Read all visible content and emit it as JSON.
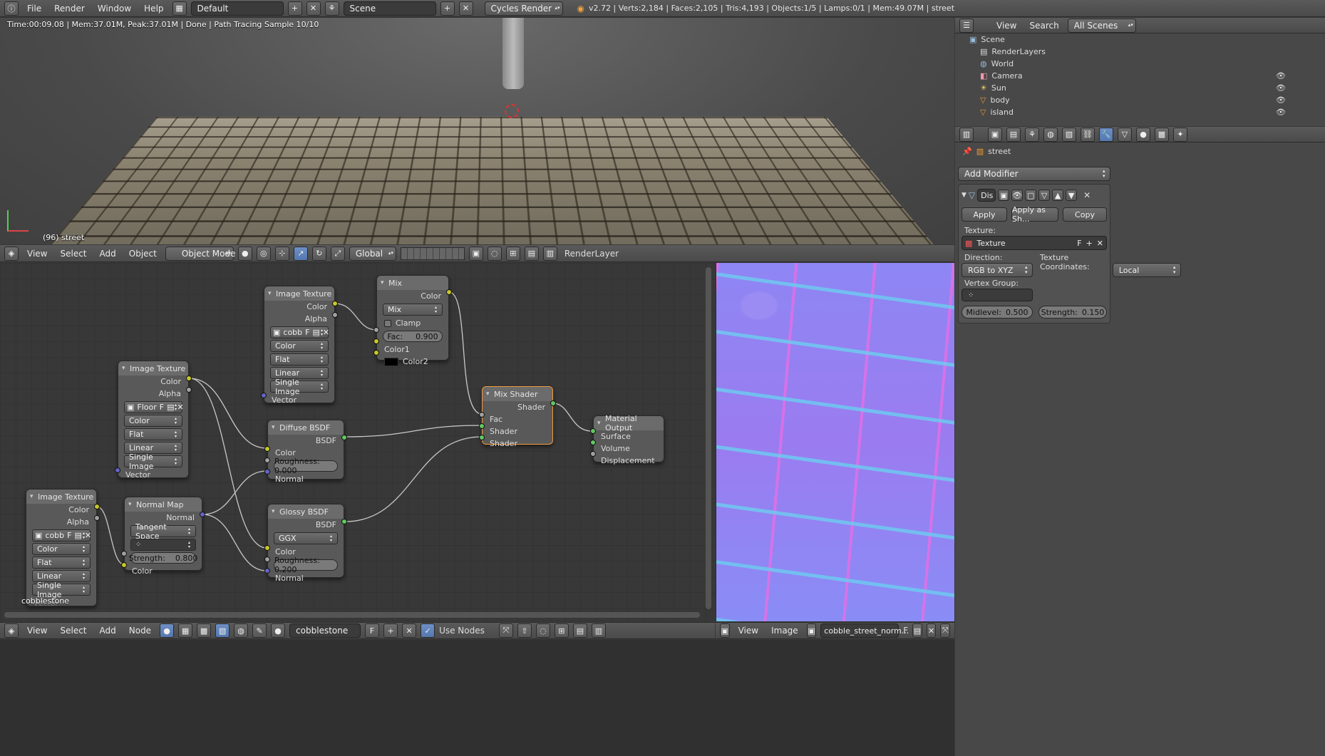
{
  "topbar": {
    "menus": [
      "File",
      "Render",
      "Window",
      "Help"
    ],
    "layout": "Default",
    "scene": "Scene",
    "engine": "Cycles Render",
    "stats": "v2.72 | Verts:2,184 | Faces:2,105 | Tris:4,193 | Objects:1/5 | Lamps:0/1 | Mem:49.07M | street"
  },
  "viewport": {
    "info": "Time:00:09.08 | Mem:37.01M, Peak:37.01M | Done | Path Tracing Sample 10/10",
    "object_label": "(96) street",
    "menus": [
      "View",
      "Select",
      "Add",
      "Object"
    ],
    "mode": "Object Mode",
    "orientation": "Global",
    "render_layer": "RenderLayer"
  },
  "outliner": {
    "menus": [
      "View",
      "Search"
    ],
    "filter": "All Scenes",
    "items": [
      "Scene",
      "RenderLayers",
      "World",
      "Camera",
      "Sun",
      "body",
      "island"
    ]
  },
  "properties": {
    "object": "street",
    "add_modifier": "Add Modifier",
    "modifier_name": "Dis",
    "apply": "Apply",
    "apply_shape": "Apply as Sh...",
    "copy": "Copy",
    "texture_label": "Texture:",
    "texture_value": "Texture",
    "texture_f": "F",
    "direction_label": "Direction:",
    "direction": "RGB to XYZ",
    "coords_label": "Texture Coordinates:",
    "coords": "Local",
    "vgroup_label": "Vertex Group:",
    "midlevel_label": "Midlevel:",
    "midlevel": "0.500",
    "strength_label": "Strength:",
    "strength": "0.150"
  },
  "nodes": {
    "img1": {
      "title": "Image Texture",
      "out1": "Color",
      "out2": "Alpha",
      "image": "cobb",
      "f": "F",
      "color": "Color",
      "proj": "Flat",
      "interp": "Linear",
      "src": "Single Image",
      "vector": "Vector"
    },
    "mix": {
      "title": "Mix",
      "out": "Color",
      "blend": "Mix",
      "clamp": "Clamp",
      "fac_label": "Fac:",
      "fac": "0.900",
      "c1": "Color1",
      "c2": "Color2"
    },
    "img2": {
      "title": "Image Texture",
      "out1": "Color",
      "out2": "Alpha",
      "image": "Floor",
      "f": "F",
      "color": "Color",
      "proj": "Flat",
      "interp": "Linear",
      "src": "Single Image",
      "vector": "Vector"
    },
    "diffuse": {
      "title": "Diffuse BSDF",
      "out": "BSDF",
      "color": "Color",
      "rough": "Roughness: 0.000",
      "normal": "Normal"
    },
    "mixshader": {
      "title": "Mix Shader",
      "out": "Shader",
      "fac": "Fac",
      "s1": "Shader",
      "s2": "Shader"
    },
    "output": {
      "title": "Material Output",
      "surface": "Surface",
      "volume": "Volume",
      "disp": "Displacement"
    },
    "img3": {
      "title": "Image Texture",
      "out1": "Color",
      "out2": "Alpha",
      "image": "cobb",
      "f": "F",
      "color": "Color",
      "proj": "Flat",
      "interp": "Linear",
      "src": "Single Image",
      "vector": "Vector"
    },
    "normalmap": {
      "title": "Normal Map",
      "out": "Normal",
      "space": "Tangent Space",
      "strength_label": "Strength:",
      "strength": "0.800",
      "color": "Color"
    },
    "glossy": {
      "title": "Glossy BSDF",
      "out": "BSDF",
      "dist": "GGX",
      "color": "Color",
      "rough": "Roughness: 0.200",
      "normal": "Normal"
    }
  },
  "node_editor": {
    "material_label": "cobblestone",
    "menus": [
      "View",
      "Select",
      "Add",
      "Node"
    ],
    "material": "cobblestone",
    "f": "F",
    "use_nodes": "Use Nodes"
  },
  "image_editor": {
    "menus": [
      "View",
      "Image"
    ],
    "image": "cobble_street_norm...",
    "f": "F"
  },
  "colors": {
    "accent": "#5578b0",
    "selected_node": "#f59a3e",
    "socket_color": "#c7c729",
    "socket_shader": "#63c763",
    "socket_vector": "#6363c7"
  }
}
